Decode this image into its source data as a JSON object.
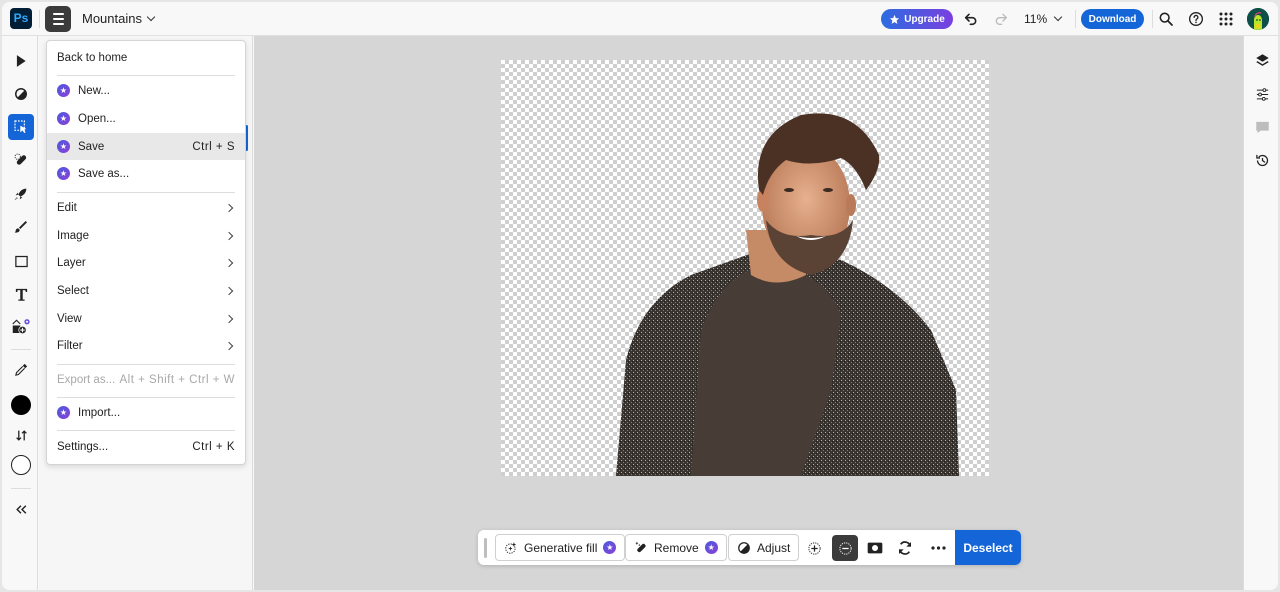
{
  "app": {
    "logo": "Ps",
    "document_title": "Mountains",
    "zoom_level": "11%"
  },
  "header": {
    "upgrade_label": "Upgrade",
    "download_label": "Download",
    "icons": [
      "undo-icon",
      "redo-icon",
      "search-icon",
      "help-icon",
      "apps-grid-icon",
      "avatar"
    ]
  },
  "colors": {
    "accent_blue": "#1466d8",
    "premium_purple": "#7a3fe0",
    "menu_highlight": "#e8e8e8"
  },
  "left_toolbar": {
    "tools": [
      "move-tool",
      "adjustment-tool",
      "selection-tool",
      "healing-tool",
      "quick-actions-tool",
      "brush-tool",
      "shape-tool",
      "text-tool",
      "add-image-tool",
      "eyedropper-tool",
      "foreground-color",
      "swap-colors",
      "background-color",
      "collapse-toolbar"
    ],
    "active_tool": "selection-tool",
    "foreground_color": "#000000",
    "background_color": "#ffffff"
  },
  "menu": {
    "items": [
      {
        "label": "Back to home",
        "type": "plain"
      },
      {
        "label": "New...",
        "type": "premium"
      },
      {
        "label": "Open...",
        "type": "premium"
      },
      {
        "label": "Save",
        "type": "premium",
        "shortcut": "Ctrl + S",
        "highlighted": true
      },
      {
        "label": "Save as...",
        "type": "premium"
      },
      {
        "label": "Edit",
        "type": "submenu"
      },
      {
        "label": "Image",
        "type": "submenu"
      },
      {
        "label": "Layer",
        "type": "submenu"
      },
      {
        "label": "Select",
        "type": "submenu"
      },
      {
        "label": "View",
        "type": "submenu"
      },
      {
        "label": "Filter",
        "type": "submenu"
      },
      {
        "label": "Export as...",
        "type": "disabled",
        "shortcut": "Alt + Shift + Ctrl + W"
      },
      {
        "label": "Import...",
        "type": "premium"
      },
      {
        "label": "Settings...",
        "type": "plain",
        "shortcut": "Ctrl + K"
      }
    ]
  },
  "right_toolbar": {
    "icons": [
      "layers-icon",
      "adjustments-icon",
      "comments-icon",
      "history-icon"
    ]
  },
  "taskbar": {
    "generative_fill_label": "Generative fill",
    "remove_label": "Remove",
    "adjust_label": "Adjust",
    "deselect_label": "Deselect",
    "icons": [
      "add-to-selection-icon",
      "subtract-from-selection-icon",
      "mask-icon",
      "invert-selection-icon",
      "more-icon"
    ],
    "active_icon": "subtract-from-selection-icon"
  },
  "canvas": {
    "content": "Portrait of smiling bearded man in tweed jacket and brown t-shirt on transparent background"
  }
}
